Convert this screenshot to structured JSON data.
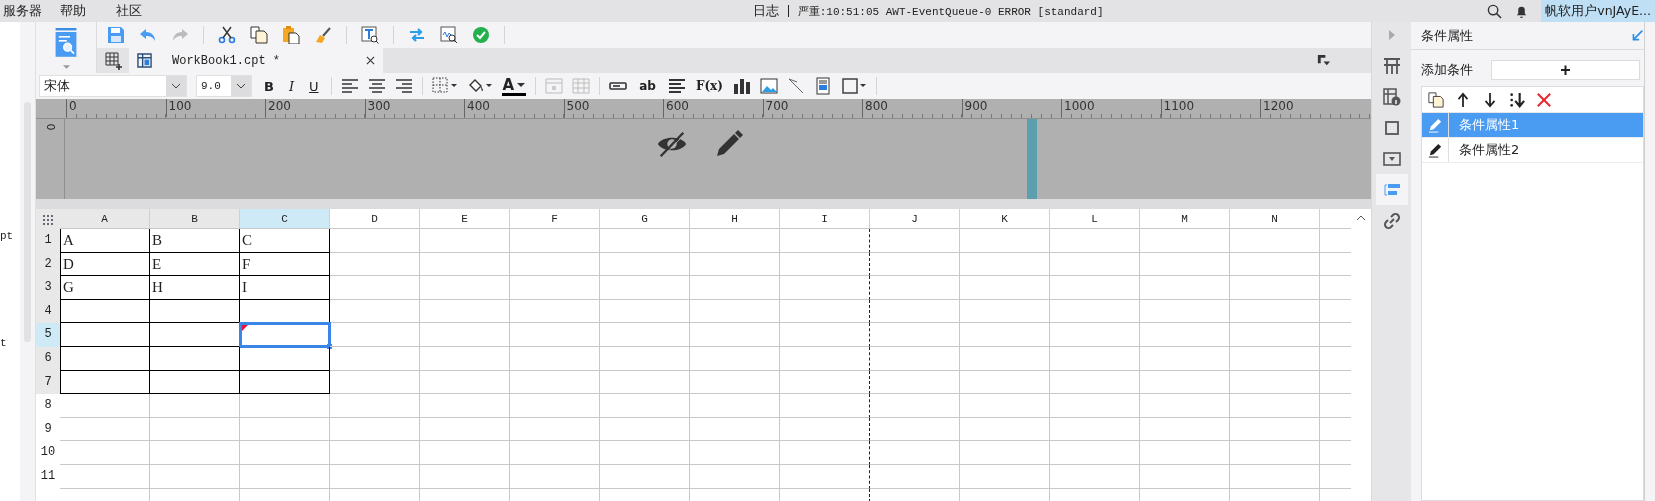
{
  "menu": [
    "服务器",
    "帮助",
    "社区"
  ],
  "log": {
    "label": "日志",
    "message": "严重:10:51:05 AWT-EventQueue-0 ERROR [standard]"
  },
  "user": "帆软用户vnJAyE...",
  "left_panel": {
    "items": [
      "pt",
      "t"
    ]
  },
  "tab": {
    "title": "WorkBook1.cpt *"
  },
  "font": {
    "family": "宋体",
    "size": "9.0"
  },
  "style_buttons": [
    "B",
    "I",
    "U"
  ],
  "font_color_label": "A",
  "insert_text_buttons": [
    "ab",
    "F(x)"
  ],
  "ruler": {
    "h_labels": [
      "0",
      "100",
      "200",
      "300",
      "400",
      "500",
      "600",
      "700",
      "800",
      "900",
      "1000",
      "1100",
      "1200"
    ],
    "v_label": "0"
  },
  "grid": {
    "columns": [
      {
        "label": "A",
        "selected": false,
        "bordered": true,
        "page_break": false
      },
      {
        "label": "B",
        "selected": false,
        "bordered": true,
        "page_break": false
      },
      {
        "label": "C",
        "selected": true,
        "bordered": true,
        "page_break": false
      },
      {
        "label": "D",
        "selected": false,
        "bordered": false,
        "page_break": false
      },
      {
        "label": "E",
        "selected": false,
        "bordered": false,
        "page_break": false
      },
      {
        "label": "F",
        "selected": false,
        "bordered": false,
        "page_break": false
      },
      {
        "label": "G",
        "selected": false,
        "bordered": false,
        "page_break": false
      },
      {
        "label": "H",
        "selected": false,
        "bordered": false,
        "page_break": false
      },
      {
        "label": "I",
        "selected": false,
        "bordered": false,
        "page_break": true
      },
      {
        "label": "J",
        "selected": false,
        "bordered": false,
        "page_break": false
      },
      {
        "label": "K",
        "selected": false,
        "bordered": false,
        "page_break": false
      },
      {
        "label": "L",
        "selected": false,
        "bordered": false,
        "page_break": false
      },
      {
        "label": "M",
        "selected": false,
        "bordered": false,
        "page_break": false
      },
      {
        "label": "N",
        "selected": false,
        "bordered": false,
        "page_break": false
      }
    ],
    "rows": [
      {
        "label": "1",
        "selected": false,
        "bordered": true,
        "cells": [
          "A",
          "B",
          "C"
        ]
      },
      {
        "label": "2",
        "selected": false,
        "bordered": true,
        "cells": [
          "D",
          "E",
          "F"
        ]
      },
      {
        "label": "3",
        "selected": false,
        "bordered": true,
        "cells": [
          "G",
          "H",
          "I"
        ]
      },
      {
        "label": "4",
        "selected": false,
        "bordered": true
      },
      {
        "label": "5",
        "selected": true,
        "bordered": true
      },
      {
        "label": "6",
        "selected": false,
        "bordered": true
      },
      {
        "label": "7",
        "selected": false,
        "bordered": true
      },
      {
        "label": "8",
        "selected": false,
        "bordered": false
      },
      {
        "label": "9",
        "selected": false,
        "bordered": false
      },
      {
        "label": "10",
        "selected": false,
        "bordered": false
      },
      {
        "label": "11",
        "selected": false,
        "bordered": false
      }
    ]
  },
  "side_tabs": [
    {
      "selected": false
    },
    {
      "selected": false
    },
    {
      "selected": false
    },
    {
      "selected": false
    },
    {
      "selected": true
    },
    {
      "selected": false
    }
  ],
  "panel": {
    "title": "条件属性",
    "add_label": "添加条件",
    "add_button": "+",
    "items": [
      {
        "label": "条件属性1",
        "selected": true
      },
      {
        "label": "条件属性2",
        "selected": false
      }
    ]
  }
}
